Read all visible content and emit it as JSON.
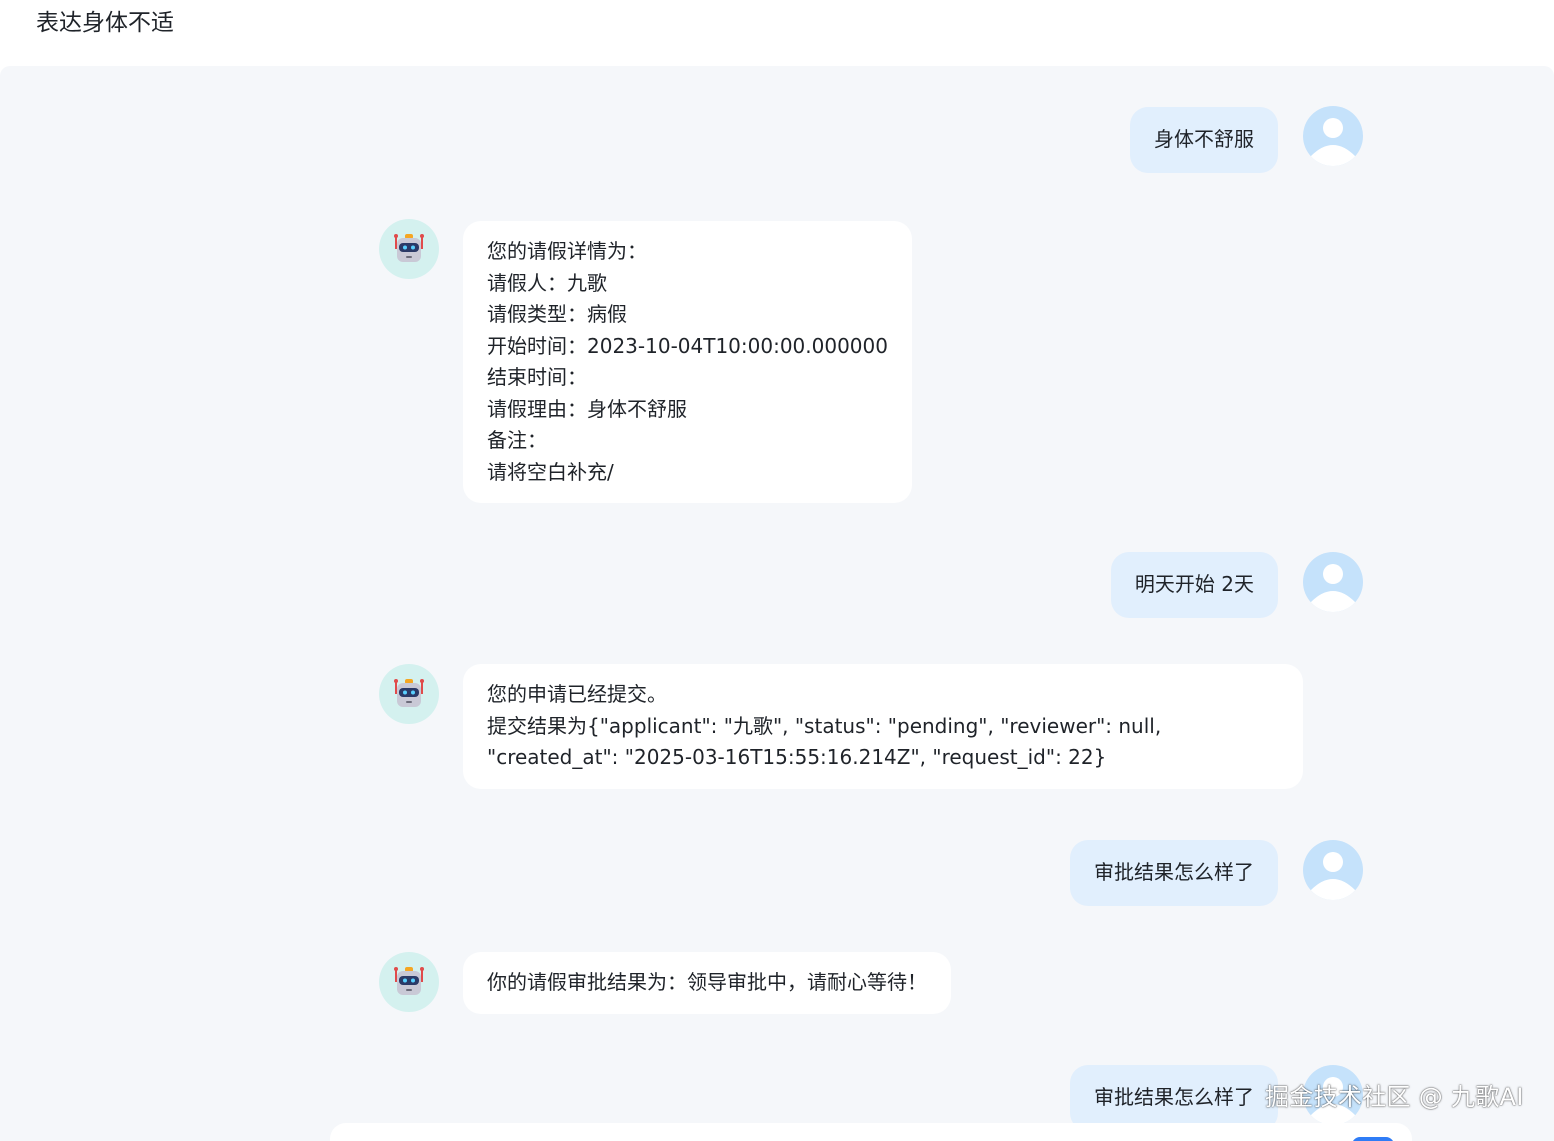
{
  "header": {
    "title": "表达身体不适"
  },
  "messages": [
    {
      "role": "user",
      "text": "身体不舒服"
    },
    {
      "role": "bot",
      "text": "您的请假详情为：\n请假人：九歌\n请假类型：病假\n开始时间：2023-10-04T10:00:00.000000\n结束时间：\n请假理由：身体不舒服\n备注：\n请将空白补充/"
    },
    {
      "role": "user",
      "text": "明天开始 2天"
    },
    {
      "role": "bot",
      "text": "您的申请已经提交。\n提交结果为{\"applicant\": \"九歌\", \"status\": \"pending\", \"reviewer\": null,\n\"created_at\": \"2025-03-16T15:55:16.214Z\", \"request_id\": 22}"
    },
    {
      "role": "user",
      "text": "审批结果怎么样了"
    },
    {
      "role": "bot",
      "text": "你的请假审批结果为：领导审批中，请耐心等待！"
    },
    {
      "role": "user",
      "text": "审批结果怎么样了"
    }
  ],
  "avatars": {
    "user_icon": "user-avatar-icon",
    "bot_icon": "robot-avatar-icon"
  },
  "watermark": "掘金技术社区 @ 九歌AI",
  "colors": {
    "user_bubble": "#e1effd",
    "bot_bubble": "#ffffff",
    "chat_background": "#f5f7fa",
    "user_avatar": "#c5e2fb",
    "bot_avatar": "#d4f1ef",
    "accent": "#2f7cf6"
  }
}
